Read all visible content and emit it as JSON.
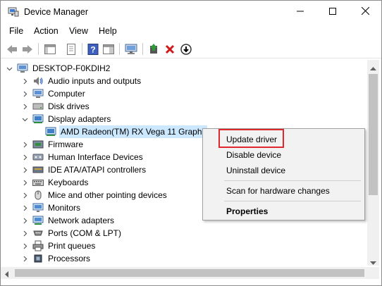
{
  "window": {
    "title": "Device Manager",
    "controls": {
      "minimize_icon": "minimize-icon",
      "maximize_icon": "maximize-icon",
      "close_icon": "close-icon"
    }
  },
  "menubar": {
    "items": [
      "File",
      "Action",
      "View",
      "Help"
    ]
  },
  "toolbar": {
    "buttons": [
      "back-arrow-icon",
      "forward-arrow-icon",
      "show-hide-tree-icon",
      "properties-icon",
      "help-icon",
      "action-pane-icon",
      "monitor-scan-icon",
      "update-driver-icon",
      "uninstall-device-icon",
      "enable-device-icon"
    ]
  },
  "tree": {
    "root": "DESKTOP-F0KDIH2",
    "items": [
      {
        "label": "Audio inputs and outputs",
        "icon": "speaker-icon",
        "state": "collapsed"
      },
      {
        "label": "Computer",
        "icon": "computer-icon",
        "state": "collapsed"
      },
      {
        "label": "Disk drives",
        "icon": "disk-drive-icon",
        "state": "collapsed"
      },
      {
        "label": "Display adapters",
        "icon": "display-adapter-icon",
        "state": "expanded"
      },
      {
        "label": "AMD Radeon(TM) RX Vega 11 Graphic",
        "icon": "display-adapter-icon",
        "state": "child-selected"
      },
      {
        "label": "Firmware",
        "icon": "firmware-icon",
        "state": "collapsed"
      },
      {
        "label": "Human Interface Devices",
        "icon": "hid-icon",
        "state": "collapsed"
      },
      {
        "label": "IDE ATA/ATAPI controllers",
        "icon": "ide-controller-icon",
        "state": "collapsed"
      },
      {
        "label": "Keyboards",
        "icon": "keyboard-icon",
        "state": "collapsed"
      },
      {
        "label": "Mice and other pointing devices",
        "icon": "mouse-icon",
        "state": "collapsed"
      },
      {
        "label": "Monitors",
        "icon": "monitor-icon",
        "state": "collapsed"
      },
      {
        "label": "Network adapters",
        "icon": "network-adapter-icon",
        "state": "collapsed"
      },
      {
        "label": "Ports (COM & LPT)",
        "icon": "port-icon",
        "state": "collapsed"
      },
      {
        "label": "Print queues",
        "icon": "printer-icon",
        "state": "collapsed"
      },
      {
        "label": "Processors",
        "icon": "processor-icon",
        "state": "collapsed"
      }
    ]
  },
  "context_menu": {
    "items": [
      "Update driver",
      "Disable device",
      "Uninstall device",
      "Scan for hardware changes",
      "Properties"
    ],
    "highlighted": "Update driver"
  },
  "colors": {
    "selection": "#cce8ff",
    "highlight_border": "#e0272d",
    "menu_bg": "#f2f2f2"
  }
}
